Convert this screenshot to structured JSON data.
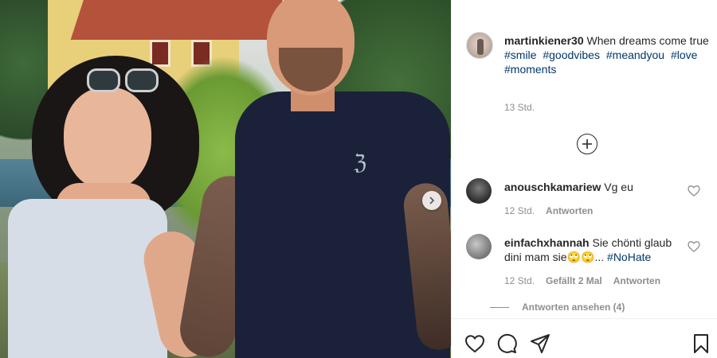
{
  "post": {
    "username": "martinkiener30",
    "caption": "When dreams come true",
    "hashtags": [
      "#smile",
      "#goodvibes",
      "#meandyou",
      "#love",
      "#moments"
    ],
    "time": "13 Std."
  },
  "comments": [
    {
      "username": "anouschkamariew",
      "text": "Vg eu",
      "time": "12 Std.",
      "reply_label": "Antworten"
    },
    {
      "username": "einfachxhannah",
      "text": "Sie chönti glaub dini mam sie",
      "emojis": "🙄🙄...",
      "hashtag": "#NoHate",
      "time": "12 Std.",
      "likes_label": "Gefällt 2 Mal",
      "reply_label": "Antworten"
    }
  ],
  "view_replies": "Antworten ansehen (4)",
  "photo": {
    "shirt_logo": "ℨ"
  },
  "icons": {
    "like": "heart-icon",
    "comment": "comment-icon",
    "share": "send-icon",
    "save": "bookmark-icon",
    "load_more": "plus-circle-icon",
    "next": "chevron-right-icon"
  },
  "colors": {
    "link": "#00376b",
    "muted": "#8e8e8e",
    "text": "#262626"
  }
}
